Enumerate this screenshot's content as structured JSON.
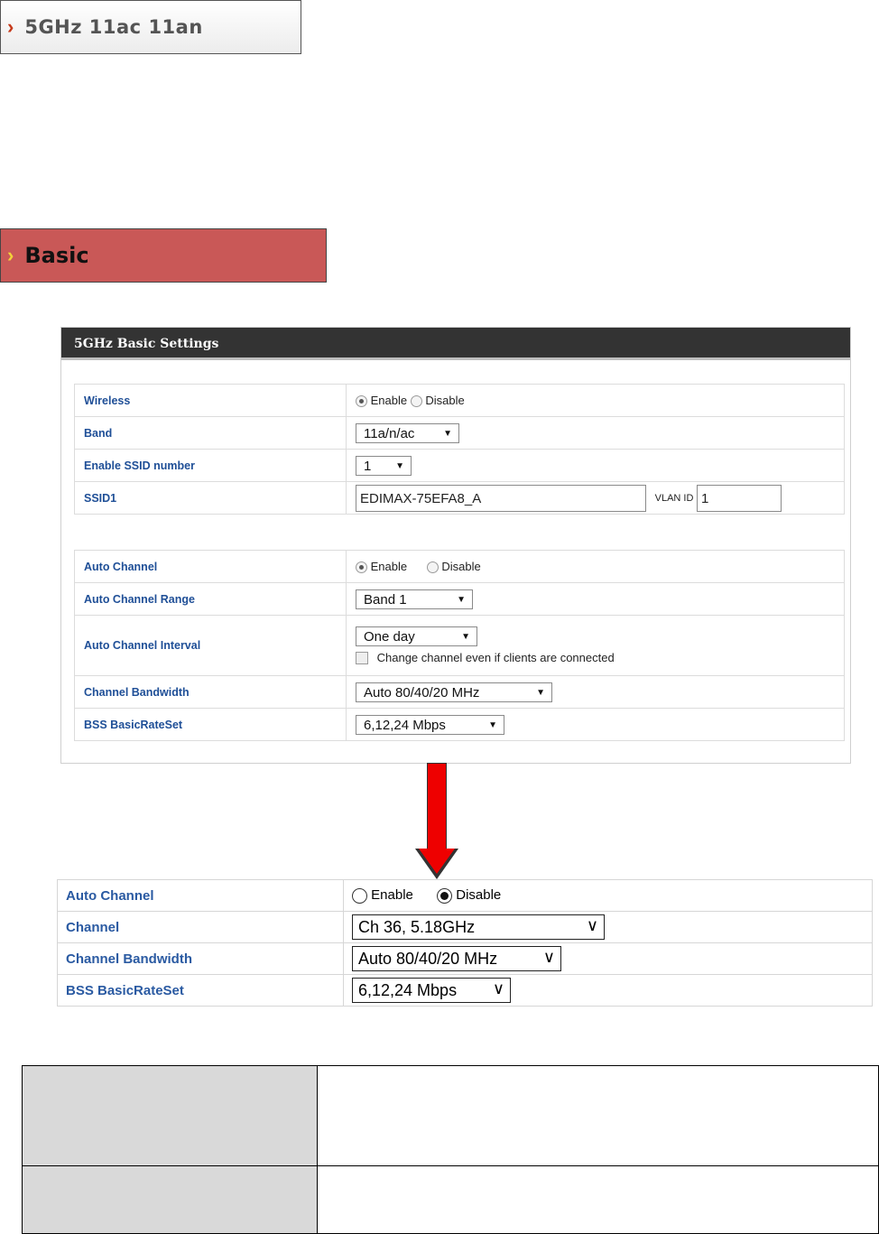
{
  "section1": {
    "chevron": "›",
    "title": "5GHz 11ac 11an"
  },
  "section2": {
    "chevron": "›",
    "title": "Basic"
  },
  "panel": {
    "header": "5GHz Basic Settings",
    "wireless": {
      "label": "Wireless",
      "enable": "Enable",
      "disable": "Disable",
      "selected": "Enable"
    },
    "band": {
      "label": "Band",
      "value": "11a/n/ac"
    },
    "ssid_number": {
      "label": "Enable SSID number",
      "value": "1"
    },
    "ssid1": {
      "label": "SSID1",
      "value": "EDIMAX-75EFA8_A",
      "vlan_label": "VLAN ID",
      "vlan_value": "1"
    },
    "auto_channel": {
      "label": "Auto Channel",
      "enable": "Enable",
      "disable": "Disable",
      "selected": "Enable"
    },
    "auto_channel_range": {
      "label": "Auto Channel Range",
      "value": "Band 1"
    },
    "auto_channel_interval": {
      "label": "Auto Channel Interval",
      "value": "One day",
      "checkbox_label": "Change channel even if clients are connected"
    },
    "channel_bandwidth": {
      "label": "Channel Bandwidth",
      "value": "Auto 80/40/20 MHz"
    },
    "bss_rate": {
      "label": "BSS BasicRateSet",
      "value": "6,12,24 Mbps"
    }
  },
  "detail": {
    "auto_channel": {
      "label": "Auto Channel",
      "enable": "Enable",
      "disable": "Disable",
      "selected": "Disable"
    },
    "channel": {
      "label": "Channel",
      "value": "Ch 36, 5.18GHz"
    },
    "channel_bandwidth": {
      "label": "Channel Bandwidth",
      "value": "Auto 80/40/20 MHz"
    },
    "bss_rate": {
      "label": "BSS BasicRateSet",
      "value": "6,12,24 Mbps"
    }
  },
  "arrow_color": "#ee0000",
  "icons": {
    "dropdown": "▼",
    "chevron_down": "∨"
  }
}
